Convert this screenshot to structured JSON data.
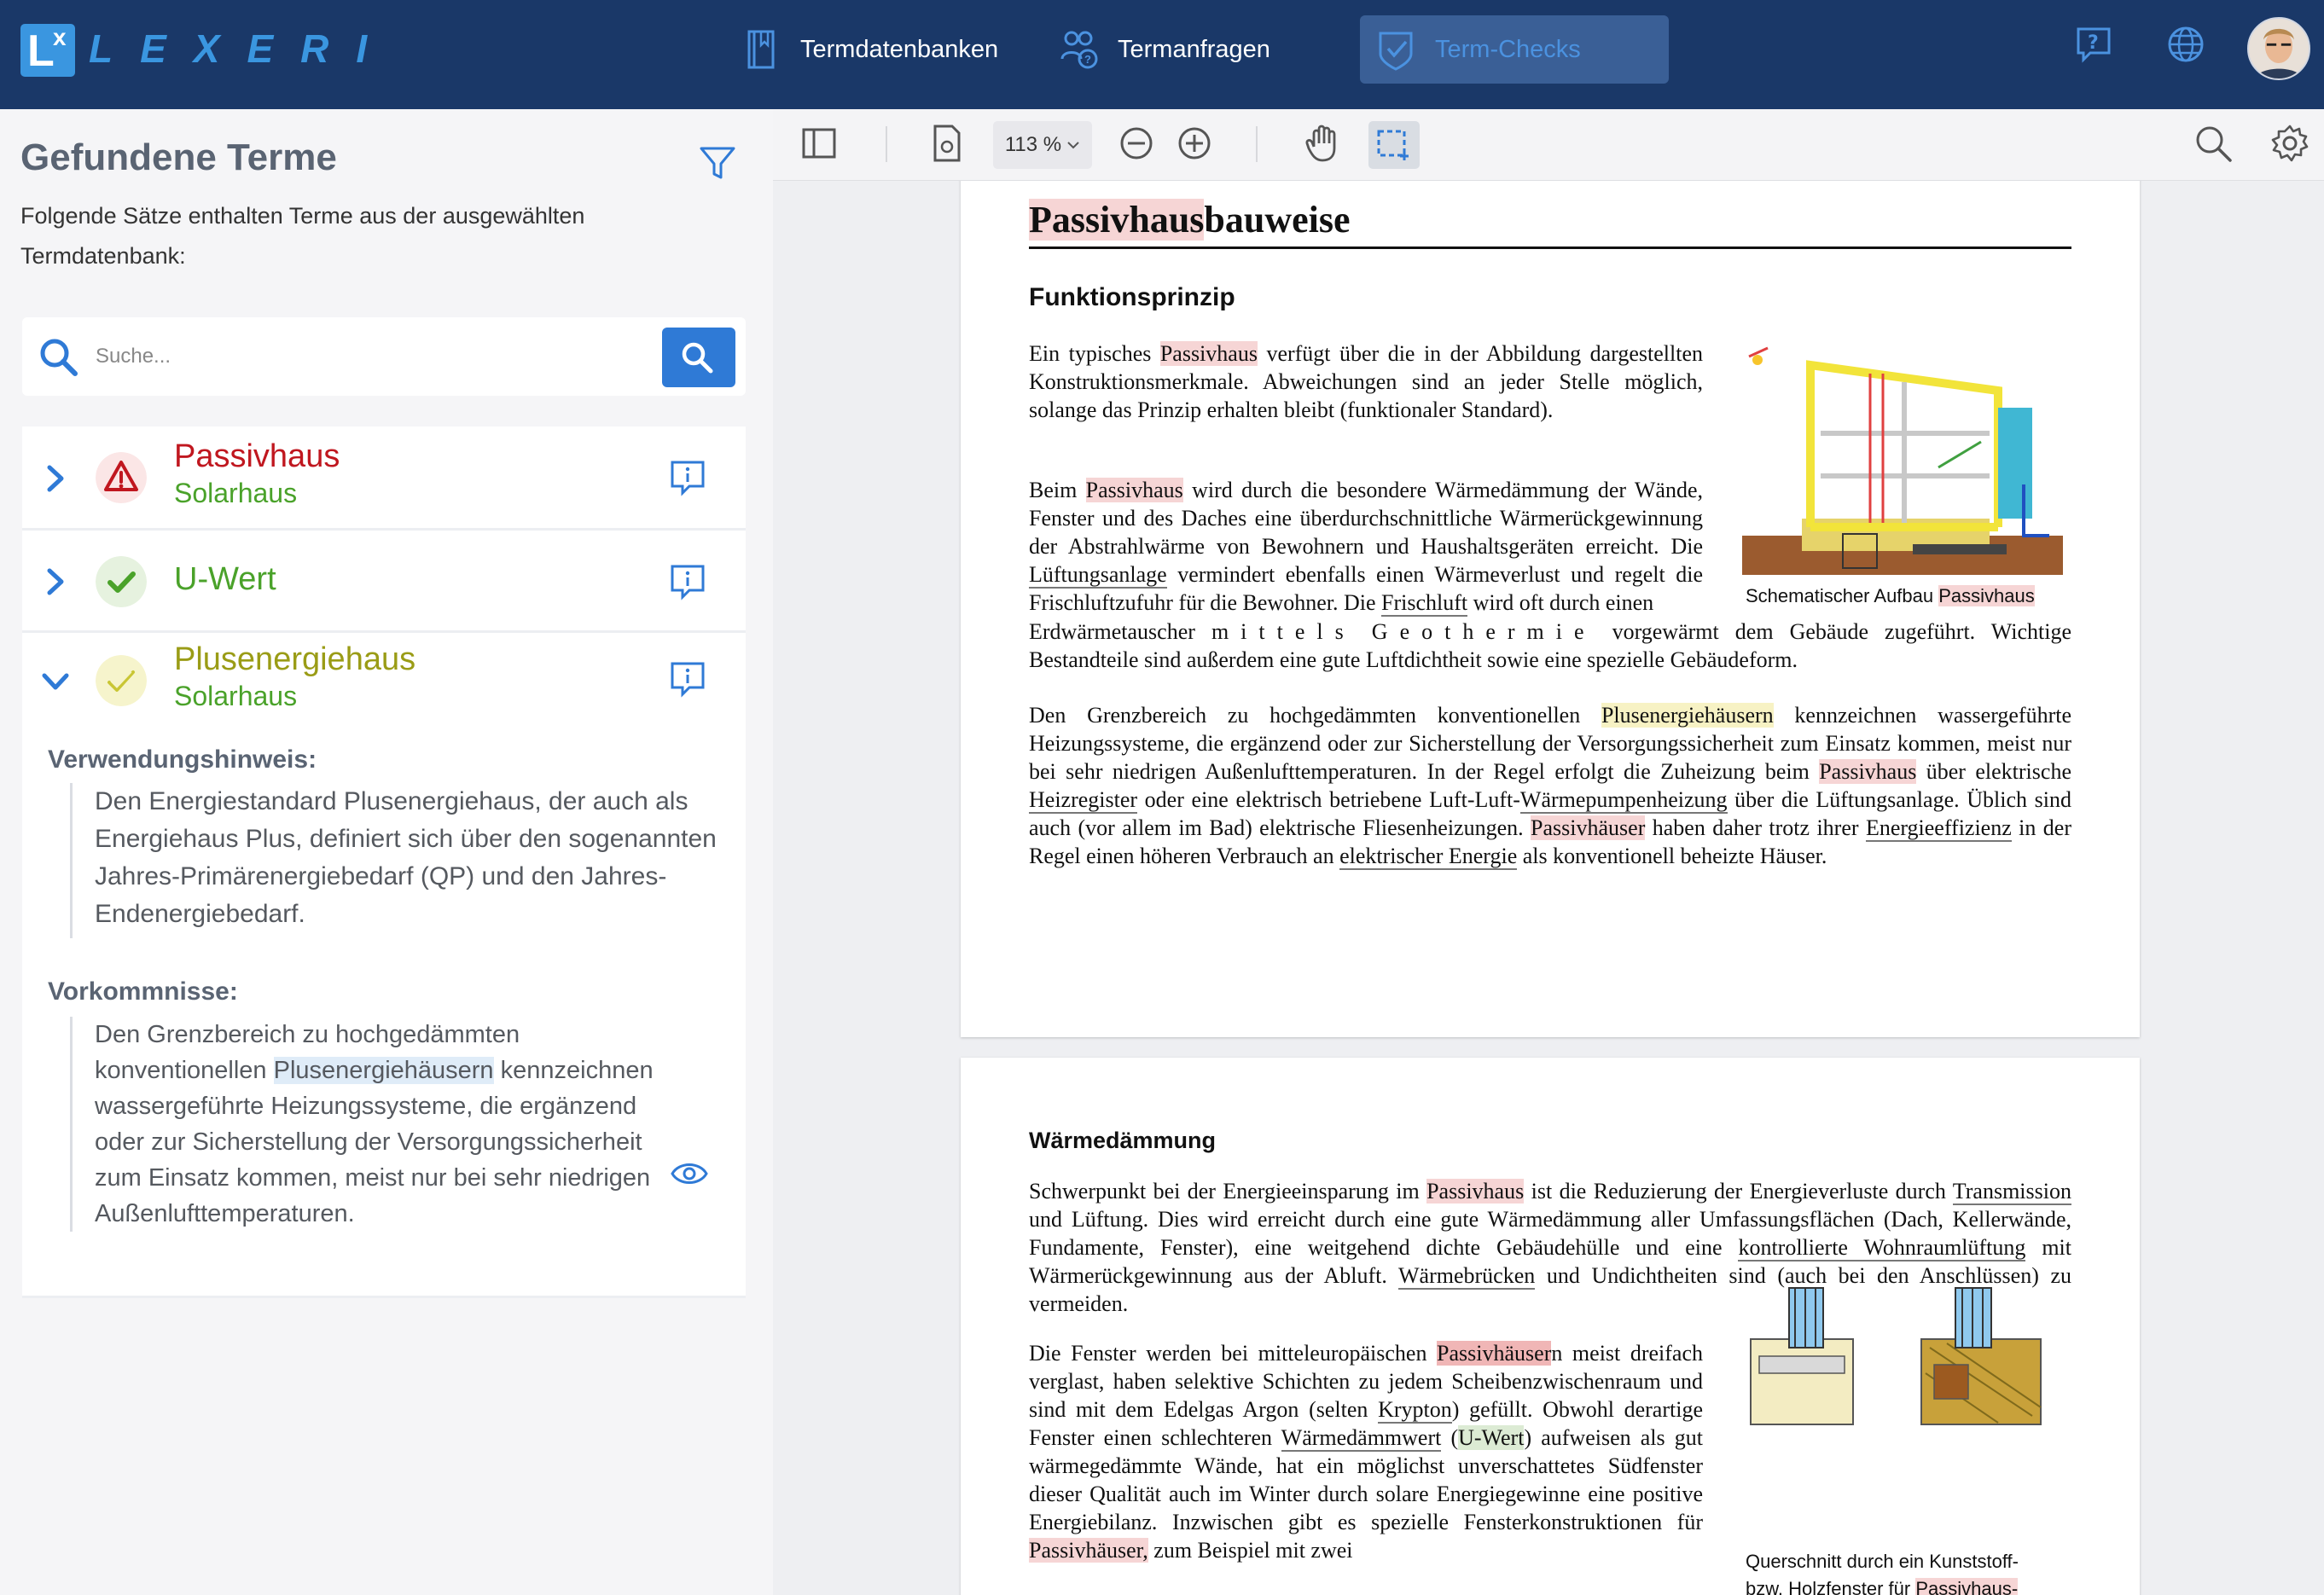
{
  "app": {
    "logo_text": "LEXERI"
  },
  "nav": {
    "termdatabanken": "Termdatenbanken",
    "termanfragen": "Termanfragen",
    "termchecks": "Term-Checks"
  },
  "panel": {
    "title": "Gefundene Terme",
    "description": "Folgende Sätze enthalten Terme aus der ausgewählten Termdatenbank:",
    "search_placeholder": "Suche...",
    "terms": [
      {
        "name": "Passivhaus",
        "sub": "Solarhaus",
        "status": "warning-icon"
      },
      {
        "name": "U-Wert",
        "status": "check-icon"
      },
      {
        "name": "Plusenergiehaus",
        "sub": "Solarhaus",
        "status": "check-outline-icon"
      }
    ],
    "usage_title": "Verwendungshinweis:",
    "usage_text": "Den Energiestandard Plusenergiehaus, der auch als Energiehaus Plus, definiert sich über den sogenannten Jahres-Primärenergiebedarf (QP) und den Jahres-Endenergiebedarf.",
    "occ_title": "Vorkommnisse:",
    "occ_text_pre": "Den Grenzbereich zu hochgedämmten konventionellen ",
    "occ_text_hl": "Plusenergiehäusern",
    "occ_text_post": " kennzeichnen wassergeführte Heizungssysteme, die ergänzend oder zur Sicherstellung der Versorgungssicherheit zum Einsatz kommen, meist nur bei sehr niedrigen Außenlufttemperaturen."
  },
  "viewer": {
    "zoom": "113 %"
  },
  "document": {
    "title_hl": "Passivhaus",
    "title_rest": "bauweise",
    "h_func": "Funktionsprinzip",
    "h_waerme": "Wärmedämmung",
    "fig1_caption_pre": "Schematischer Aufbau ",
    "fig1_caption_hl": "Passivhaus",
    "fig2_caption_line1": "Querschnitt durch ein Kunststoff-",
    "fig2_caption_line2": "bzw. Holzfenster für ",
    "fig2_caption_hl": "Passivhaus-"
  },
  "colors": {
    "topbar": "#1a3868",
    "accent": "#2f7ad6",
    "warning": "#c0171f",
    "ok": "#4aa22a",
    "olive": "#9a9c16"
  }
}
